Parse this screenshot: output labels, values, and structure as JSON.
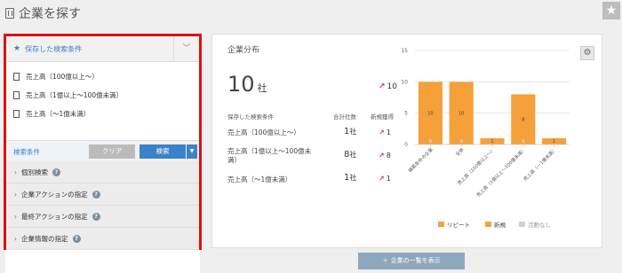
{
  "header": {
    "title": "企業を探す",
    "star_icon": "★"
  },
  "saved": {
    "header_label": "保存した検索条件",
    "items": [
      {
        "label": "売上高（100億以上～）"
      },
      {
        "label": "売上高（1億以上～100億未満）"
      },
      {
        "label": "売上高（～1億未満）"
      }
    ]
  },
  "search": {
    "label": "検索条件",
    "clear": "クリア",
    "search": "検索"
  },
  "accordion": [
    {
      "label": "個別検索"
    },
    {
      "label": "企業アクションの指定"
    },
    {
      "label": "最終アクションの指定"
    },
    {
      "label": "企業情報の指定"
    }
  ],
  "dist": {
    "title": "企業分布",
    "total": "10",
    "unit": "社",
    "new_total": "10",
    "col_saved": "保存した検索条件",
    "col_total": "合計社数",
    "col_new": "新規獲得",
    "rows": [
      {
        "label": "売上高（100億以上～）",
        "count": "1",
        "unit": "社",
        "new": "1"
      },
      {
        "label": "売上高（1億以上～100億未満）",
        "count": "8",
        "unit": "社",
        "new": "8"
      },
      {
        "label": "売上高（～1億未満）",
        "count": "1",
        "unit": "社",
        "new": "1"
      }
    ]
  },
  "chart_data": {
    "type": "bar",
    "categories": [
      "検索条件の企業",
      "全体",
      "売上高（100億以上～）",
      "売上高（1億以上～100億未満）",
      "売上高（～1億未満）"
    ],
    "series": [
      {
        "name": "リピート",
        "values": [
          0,
          0,
          0,
          0,
          0
        ]
      },
      {
        "name": "新規",
        "values": [
          10,
          10,
          1,
          8,
          1
        ]
      },
      {
        "name": "活動なし",
        "values": [
          0,
          0,
          0,
          0,
          0
        ]
      }
    ],
    "ylim": [
      0,
      15
    ],
    "yticks": [
      0,
      5,
      10,
      15
    ],
    "colors": {
      "リピート": "#f5a03a",
      "新規": "#f5a03a",
      "活動なし": "#cfcfcf"
    },
    "legend": "bottom"
  },
  "list_button": "企業の一覧を表示"
}
